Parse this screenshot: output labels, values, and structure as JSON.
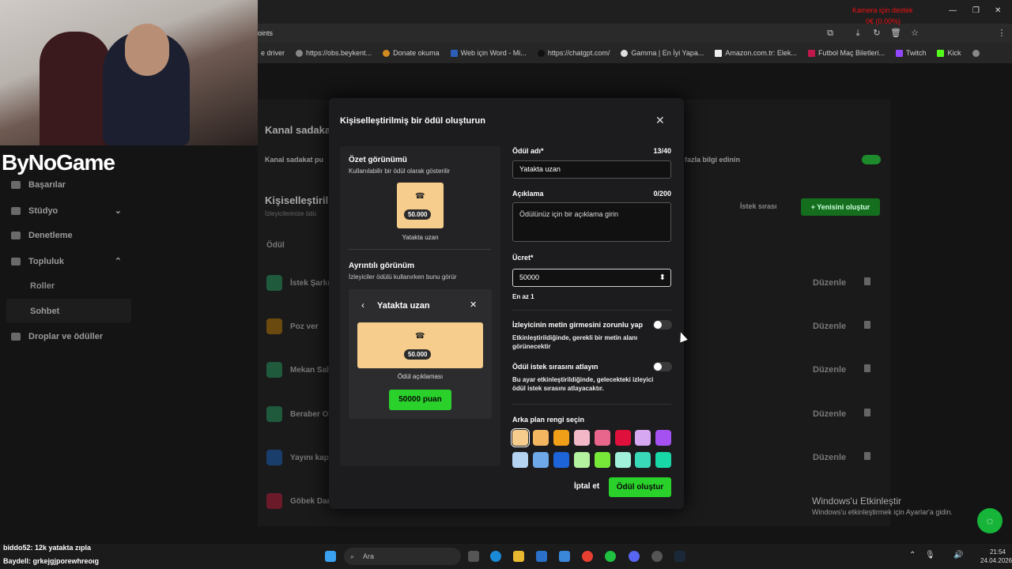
{
  "browser": {
    "url_partial": "oints",
    "recording_overlay": "Kamera için destek",
    "recording_sub": "0€ (0.00%)",
    "bookmarks": [
      "e driver",
      "https://obs.beykent...",
      "Donate okuma",
      "Web için Word - Mi...",
      "https://chatgpt.com/",
      "Gamma | En İyi Yapa...",
      "Amazon.com.tr: Elek...",
      "Futbol Maç Biletleri...",
      "Twitch",
      "Kick"
    ]
  },
  "stream": {
    "logo": "ByNoGame"
  },
  "sidebar": {
    "items": [
      {
        "label": "Başarılar",
        "icon": "trophy-icon"
      },
      {
        "label": "Stüdyo",
        "icon": "studio-icon"
      },
      {
        "label": "Denetleme",
        "icon": "wrench-icon"
      },
      {
        "label": "Topluluk",
        "icon": "community-icon"
      }
    ],
    "sub_items": [
      "Roller",
      "Sohbet"
    ],
    "item_drops": {
      "label": "Droplar ve ödüller",
      "icon": "gift-icon"
    }
  },
  "background": {
    "channel_points_title": "Kanal sadakat",
    "channel_points_desc": "Kanal sadakat pu",
    "more_info": "fazla bilgi edinin",
    "custom_title": "Kişiselleştiril",
    "custom_sub": "İzleyicilerinize ödü",
    "queue": "İstek sırası",
    "new_button": "Yenisini oluştur",
    "reward_header": "Ödül",
    "rows": [
      {
        "name": "İstek Şarkı",
        "edit": "Düzenle",
        "color": "#1f5a3d"
      },
      {
        "name": "Poz ver",
        "edit": "Düzenle",
        "color": "#6b4a10"
      },
      {
        "name": "Mekan Sah",
        "edit": "Düzenle",
        "color": "#1f5a3d"
      },
      {
        "name": "Beraber Oy",
        "edit": "Düzenle",
        "color": "#1f5a3d"
      },
      {
        "name": "Yayını kapa",
        "edit": "Düzenle",
        "color": "#1a3e6b"
      },
      {
        "name": "Göbek Dar",
        "edit": "Düzenle",
        "color": "#6b1a2a"
      }
    ],
    "activate_title": "Windows'u Etkinleştir",
    "activate_sub": "Windows'u etkinleştirmek için Ayarlar'a gidin."
  },
  "modal": {
    "title": "Kişiselleştirilmiş bir ödül oluşturun",
    "preview": {
      "summary_title": "Özet görünümü",
      "summary_sub": "Kullanılabilir bir ödül olarak gösterilir",
      "cost_badge": "50.000",
      "reward_name": "Yatakta uzan",
      "detail_title": "Ayrıntılı görünüm",
      "detail_sub": "İzleyiciler ödülü kullanırken bunu görür",
      "detail_desc": "Ödül açıklaması",
      "redeem_button": "50000 puan"
    },
    "form": {
      "name_label": "Ödül adı*",
      "name_count": "13/40",
      "name_value": "Yatakta uzan",
      "desc_label": "Açıklama",
      "desc_count": "0/200",
      "desc_placeholder": "Ödülünüz için bir açıklama girin",
      "cost_label": "Ücret*",
      "cost_value": "50000",
      "cost_help": "En az 1",
      "require_text_label": "İzleyicinin metin girmesini zorunlu yap",
      "require_text_help": "Etkinleştirildiğinde, gerekli bir metin alanı görünecektir",
      "skip_queue_label": "Ödül istek sırasını atlayın",
      "skip_queue_help": "Bu ayar etkinleştirildiğinde, gelecekteki izleyici ödül istek sırasını atlayacaktır.",
      "color_label": "Arka plan rengi seçin",
      "colors": [
        "#f6cd8c",
        "#f2b660",
        "#f0a018",
        "#f2b8c8",
        "#e8668c",
        "#e0103c",
        "#d6a8f2",
        "#a550f0",
        "#b4d4f2",
        "#6ea8e8",
        "#1c64d8",
        "#b4f2a0",
        "#78e838",
        "#a0f0dc",
        "#38d8b8",
        "#18d8a8"
      ],
      "selected_color": "#f6cd8c",
      "cancel": "İptal et",
      "submit": "Ödül oluştur"
    }
  },
  "taskbar": {
    "search": "Ara",
    "time": "21:54",
    "date": "24.04.2026"
  },
  "chat": {
    "line1": "biddo52: 12k yatakta zıpla",
    "line2": "Baydell: grkejgjporewhreoıg"
  }
}
